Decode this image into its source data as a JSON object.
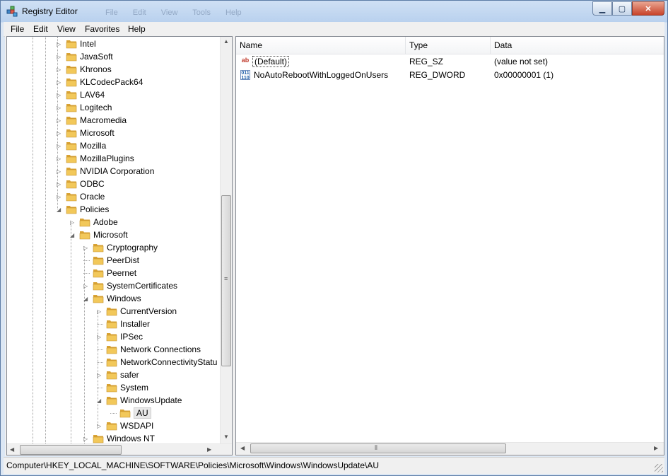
{
  "window": {
    "title": "Registry Editor",
    "icon": "regedit-icon"
  },
  "menu": [
    "File",
    "Edit",
    "View",
    "Favorites",
    "Help"
  ],
  "ghost_menu": "File Edit View Tools Help",
  "tree": [
    {
      "label": "Intel",
      "level": 0,
      "expander": "collapsed"
    },
    {
      "label": "JavaSoft",
      "level": 0,
      "expander": "collapsed"
    },
    {
      "label": "Khronos",
      "level": 0,
      "expander": "collapsed"
    },
    {
      "label": "KLCodecPack64",
      "level": 0,
      "expander": "collapsed"
    },
    {
      "label": "LAV64",
      "level": 0,
      "expander": "collapsed"
    },
    {
      "label": "Logitech",
      "level": 0,
      "expander": "collapsed"
    },
    {
      "label": "Macromedia",
      "level": 0,
      "expander": "collapsed"
    },
    {
      "label": "Microsoft",
      "level": 0,
      "expander": "collapsed"
    },
    {
      "label": "Mozilla",
      "level": 0,
      "expander": "collapsed"
    },
    {
      "label": "MozillaPlugins",
      "level": 0,
      "expander": "collapsed"
    },
    {
      "label": "NVIDIA Corporation",
      "level": 0,
      "expander": "collapsed"
    },
    {
      "label": "ODBC",
      "level": 0,
      "expander": "collapsed"
    },
    {
      "label": "Oracle",
      "level": 0,
      "expander": "collapsed"
    },
    {
      "label": "Policies",
      "level": 0,
      "expander": "expanded"
    },
    {
      "label": "Adobe",
      "level": 1,
      "expander": "collapsed"
    },
    {
      "label": "Microsoft",
      "level": 1,
      "expander": "expanded"
    },
    {
      "label": "Cryptography",
      "level": 2,
      "expander": "collapsed"
    },
    {
      "label": "PeerDist",
      "level": 2,
      "expander": "none"
    },
    {
      "label": "Peernet",
      "level": 2,
      "expander": "none"
    },
    {
      "label": "SystemCertificates",
      "level": 2,
      "expander": "collapsed"
    },
    {
      "label": "Windows",
      "level": 2,
      "expander": "expanded"
    },
    {
      "label": "CurrentVersion",
      "level": 3,
      "expander": "collapsed"
    },
    {
      "label": "Installer",
      "level": 3,
      "expander": "none"
    },
    {
      "label": "IPSec",
      "level": 3,
      "expander": "collapsed"
    },
    {
      "label": "Network Connections",
      "level": 3,
      "expander": "none"
    },
    {
      "label": "NetworkConnectivityStatu",
      "level": 3,
      "expander": "none"
    },
    {
      "label": "safer",
      "level": 3,
      "expander": "collapsed"
    },
    {
      "label": "System",
      "level": 3,
      "expander": "none"
    },
    {
      "label": "WindowsUpdate",
      "level": 3,
      "expander": "expanded"
    },
    {
      "label": "AU",
      "level": 4,
      "expander": "none",
      "selected": true
    },
    {
      "label": "WSDAPI",
      "level": 3,
      "expander": "collapsed"
    },
    {
      "label": "Windows NT",
      "level": 2,
      "expander": "collapsed"
    }
  ],
  "list": {
    "columns": [
      "Name",
      "Type",
      "Data"
    ],
    "rows": [
      {
        "icon": "string-value-icon",
        "name": "(Default)",
        "type": "REG_SZ",
        "data": "(value not set)"
      },
      {
        "icon": "binary-value-icon",
        "name": "NoAutoRebootWithLoggedOnUsers",
        "type": "REG_DWORD",
        "data": "0x00000001 (1)"
      }
    ]
  },
  "status": "Computer\\HKEY_LOCAL_MACHINE\\SOFTWARE\\Policies\\Microsoft\\Windows\\WindowsUpdate\\AU",
  "colors": {
    "folder": "#f2c85a",
    "folder_dark": "#d9a334",
    "selection": "#3399ff"
  }
}
